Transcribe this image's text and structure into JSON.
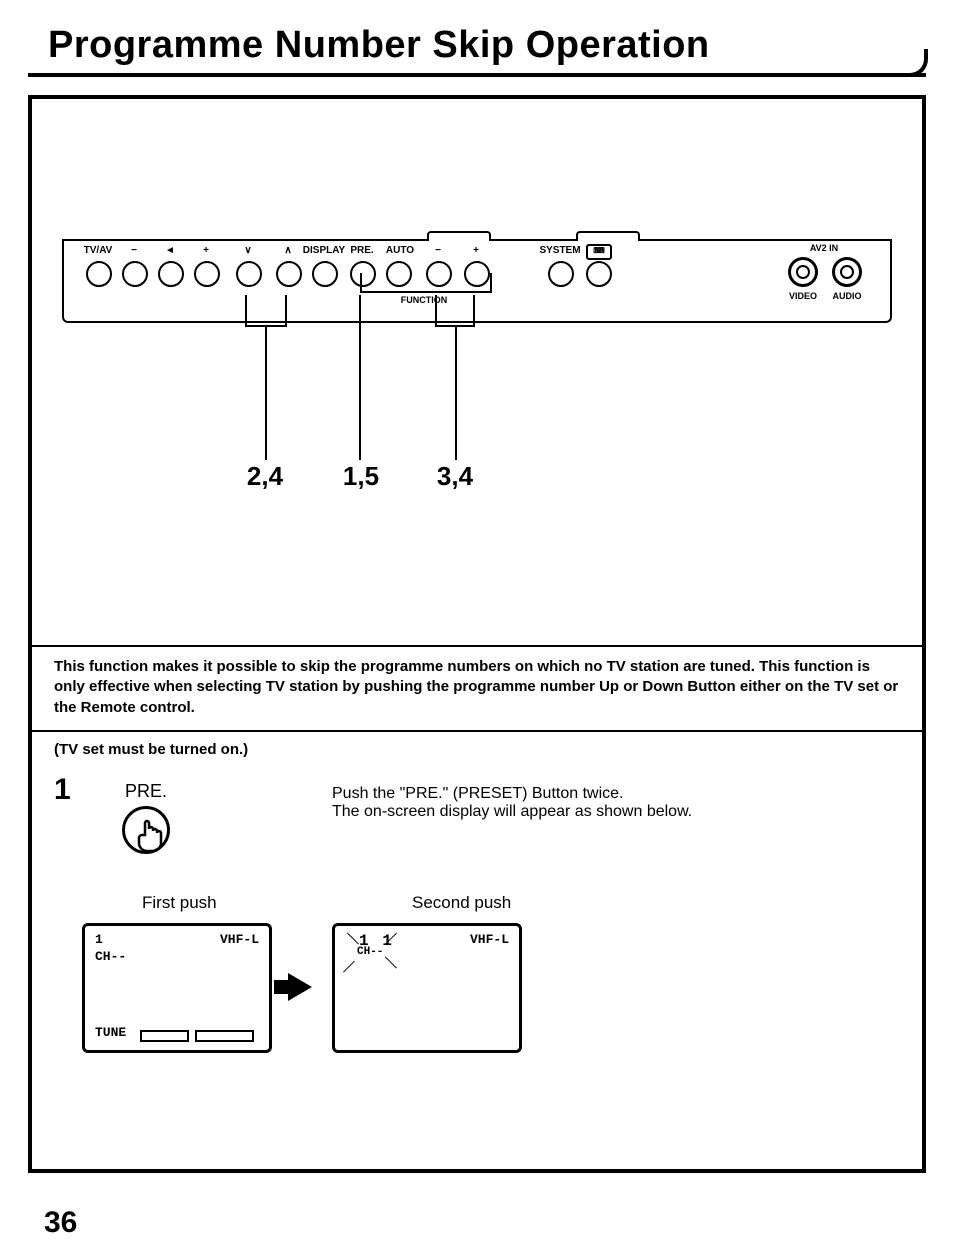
{
  "title": "Programme Number Skip Operation",
  "page_number": "36",
  "panel": {
    "buttons": [
      "TV/AV",
      "−",
      "◄",
      "+",
      "∨",
      "∧",
      "DISPLAY",
      "PRE.",
      "AUTO",
      "−",
      "+",
      "SYSTEM",
      ""
    ],
    "function_label": "FUNCTION",
    "av2_header": "AV2  IN",
    "jacks": [
      "VIDEO",
      "AUDIO"
    ]
  },
  "callouts": {
    "left": "2,4",
    "mid": "1,5",
    "right": "3,4"
  },
  "description": "This function makes it possible to skip the programme numbers on which no TV station are tuned. This function is only effective when selecting TV station by pushing the programme number Up or Down Button either on the TV set or the Remote control.",
  "step1": {
    "note": "(TV set must be turned on.)",
    "number": "1",
    "pre_label": "PRE.",
    "instruction_line1": "Push the \"PRE.\" (PRESET) Button twice.",
    "instruction_line2": "The on-screen display will appear as shown below.",
    "first_push": "First push",
    "second_push": "Second push",
    "screen1": {
      "prog": "1",
      "band": "VHF-L",
      "ch": "CH--",
      "tune": "TUNE"
    },
    "screen2": {
      "prog": "1 1",
      "band": "VHF-L",
      "ch": "CH--"
    }
  }
}
